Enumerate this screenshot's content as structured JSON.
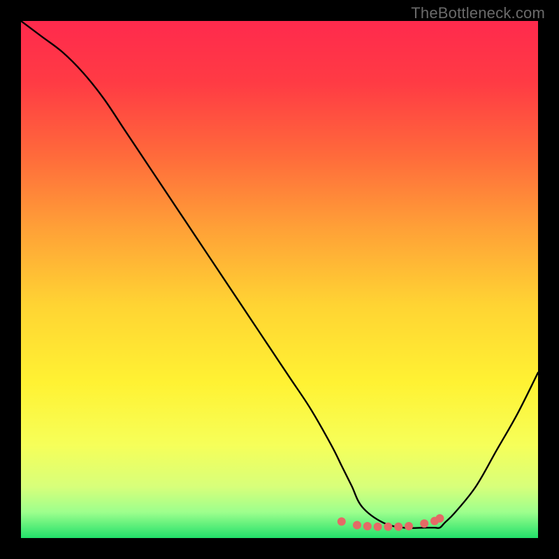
{
  "watermark": "TheBottleneck.com",
  "chart_data": {
    "type": "line",
    "title": "",
    "xlabel": "",
    "ylabel": "",
    "xlim": [
      0,
      100
    ],
    "ylim": [
      0,
      100
    ],
    "series": [
      {
        "name": "curve",
        "x": [
          0,
          4,
          8,
          12,
          16,
          20,
          24,
          28,
          32,
          36,
          40,
          44,
          48,
          52,
          56,
          60,
          62,
          63,
          64,
          66,
          70,
          74,
          78,
          80,
          81,
          82,
          84,
          88,
          92,
          96,
          100
        ],
        "y": [
          100,
          97,
          94,
          90,
          85,
          79,
          73,
          67,
          61,
          55,
          49,
          43,
          37,
          31,
          25,
          18,
          14,
          12,
          10,
          6,
          3,
          2,
          2,
          2,
          2,
          3,
          5,
          10,
          17,
          24,
          32
        ]
      }
    ],
    "markers": {
      "name": "valley-dots",
      "color": "#e46a66",
      "points": [
        {
          "x": 62,
          "y": 3.2
        },
        {
          "x": 65,
          "y": 2.5
        },
        {
          "x": 67,
          "y": 2.3
        },
        {
          "x": 69,
          "y": 2.2
        },
        {
          "x": 71,
          "y": 2.2
        },
        {
          "x": 73,
          "y": 2.2
        },
        {
          "x": 75,
          "y": 2.3
        },
        {
          "x": 78,
          "y": 2.8
        },
        {
          "x": 80,
          "y": 3.3
        },
        {
          "x": 81,
          "y": 3.8
        }
      ]
    },
    "gradient_stops": [
      {
        "offset": 0.0,
        "color": "#ff2a4d"
      },
      {
        "offset": 0.12,
        "color": "#ff3b44"
      },
      {
        "offset": 0.26,
        "color": "#ff6a3b"
      },
      {
        "offset": 0.4,
        "color": "#ffa037"
      },
      {
        "offset": 0.55,
        "color": "#ffd433"
      },
      {
        "offset": 0.7,
        "color": "#fff233"
      },
      {
        "offset": 0.82,
        "color": "#f6ff59"
      },
      {
        "offset": 0.9,
        "color": "#d8ff7a"
      },
      {
        "offset": 0.95,
        "color": "#9dff8d"
      },
      {
        "offset": 1.0,
        "color": "#22e06a"
      }
    ]
  }
}
